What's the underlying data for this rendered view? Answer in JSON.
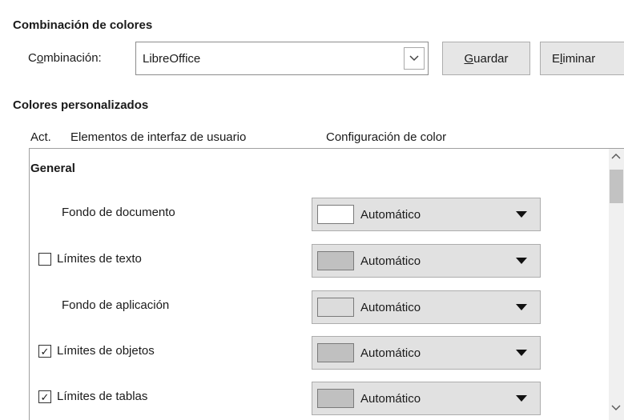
{
  "scheme": {
    "title": "Combinación de colores",
    "label_pre": "C",
    "label_mn": "o",
    "label_post": "mbinación:",
    "selected": "LibreOffice",
    "save_mn": "G",
    "save_rest": "uardar",
    "delete_pre": "E",
    "delete_mn": "l",
    "delete_post": "iminar"
  },
  "custom": {
    "title": "Colores personalizados",
    "headers": {
      "act": "Act.",
      "elements": "Elementos de interfaz de usuario",
      "config": "Configuración de color"
    },
    "group": "General",
    "rows": [
      {
        "label": "Fondo de documento",
        "checkbox": null,
        "value": "Automático",
        "swatch": "#ffffff"
      },
      {
        "label": "Límites de texto",
        "checkbox": "unchecked",
        "value": "Automático",
        "swatch": "#c0c0c0"
      },
      {
        "label": "Fondo de aplicación",
        "checkbox": null,
        "value": "Automático",
        "swatch": "#dcdcdc"
      },
      {
        "label": "Límites de objetos",
        "checkbox": "checked",
        "value": "Automático",
        "swatch": "#c0c0c0"
      },
      {
        "label": "Límites de tablas",
        "checkbox": "checked",
        "value": "Automático",
        "swatch": "#c0c0c0"
      }
    ],
    "check_glyph": "✓"
  },
  "icons": {
    "dropdown": "chevron-down-icon",
    "scroll_up": "chevron-up-icon",
    "scroll_down": "chevron-down-icon"
  }
}
